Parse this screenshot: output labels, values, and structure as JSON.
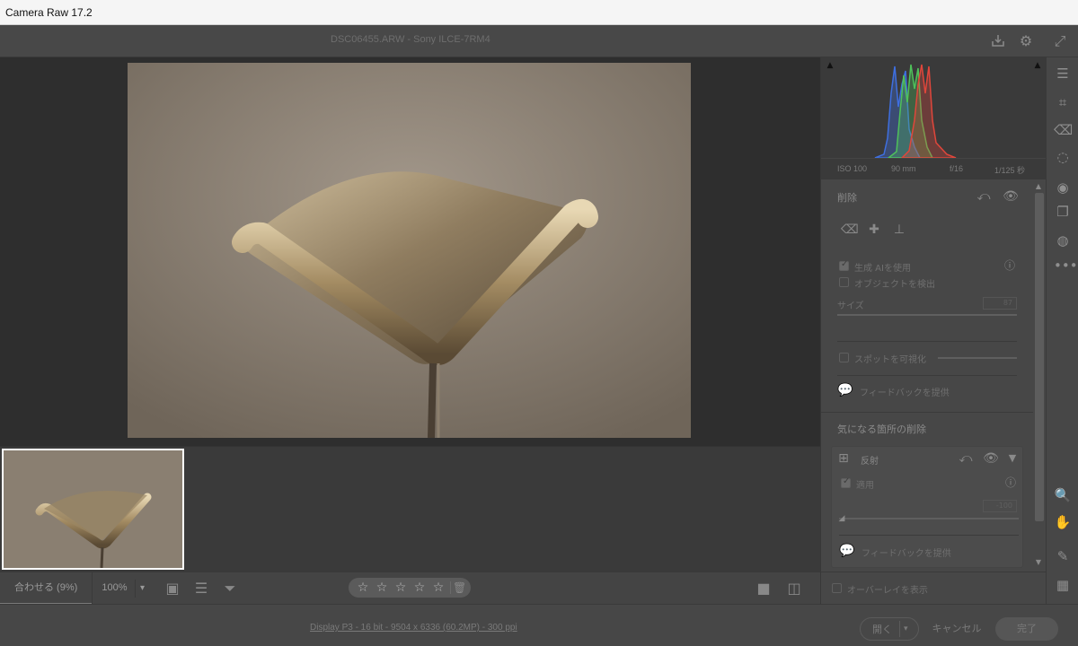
{
  "window": {
    "title": "Camera Raw 17.2"
  },
  "header": {
    "file_title": "DSC06455.ARW  -  Sony ILCE-7RM4",
    "icons": [
      "save-icon",
      "gear-icon",
      "fullscreen-icon"
    ]
  },
  "histogram": {
    "exif": {
      "iso": "ISO 100",
      "focal": "90 mm",
      "aperture": "f/16",
      "shutter": "1/125 秒"
    },
    "colors": {
      "red": "#e0463b",
      "green": "#4fc15a",
      "blue": "#3e6fe0"
    }
  },
  "remove_panel": {
    "title": "削除",
    "tools": [
      "eraser-icon",
      "bandage-icon",
      "stamp-icon"
    ],
    "use_generative_ai": {
      "label": "生成 AIを使用",
      "checked": true
    },
    "detect_objects": {
      "label": "オブジェクトを検出",
      "checked": false
    },
    "size": {
      "label": "サイズ",
      "value": "87"
    },
    "visualize_spots": {
      "label": "スポットを可視化",
      "checked": false
    },
    "feedback": "フィードバックを提供"
  },
  "distraction_panel": {
    "title": "気になる箇所の削除",
    "reflection": {
      "label": "反射",
      "apply": {
        "label": "適用",
        "checked": true
      },
      "value": "-100",
      "feedback": "フィードバックを提供"
    }
  },
  "overlay": {
    "label": "オーバーレイを表示",
    "checked": false
  },
  "bottom": {
    "zoom_fit": "合わせる (9%)",
    "zoom_100": "100%",
    "rating_stars": 5
  },
  "status": {
    "info": "Display P3 - 16 bit - 9504 x 6336 (60.2MP) - 300 ppi",
    "open": "開く",
    "cancel": "キャンセル",
    "done": "完了"
  }
}
